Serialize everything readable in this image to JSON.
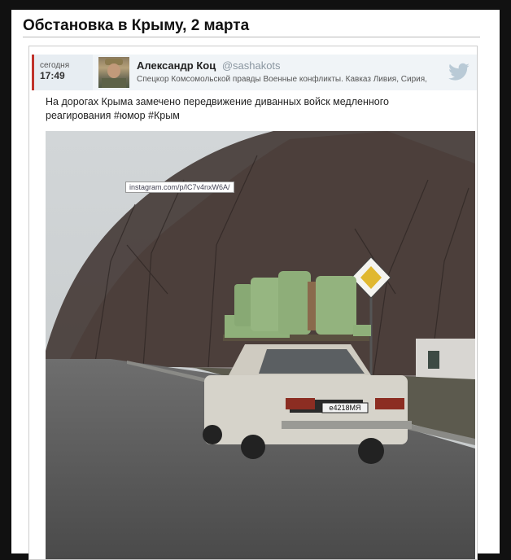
{
  "page": {
    "title": "Обстановка в Крыму, 2 марта"
  },
  "tweet": {
    "date_label": "сегодня",
    "time": "17:49",
    "author_name": "Александр Коц",
    "author_handle": "@sashakots",
    "author_bio": "Спецкор Комсомольской правды Военные конфликты. Кавказ Ливия, Сирия,",
    "text": "На дорогах Крыма замечено передвижение диванных войск медленного реагирования #юмор #Крым",
    "photo_url_label": "instagram.com/p/lC7v4nxW6A/",
    "license_plate": "е4218МЯ"
  },
  "colors": {
    "accent": "#c0332c",
    "header_bg": "#f0f4f7",
    "handle": "#8a96a0"
  }
}
